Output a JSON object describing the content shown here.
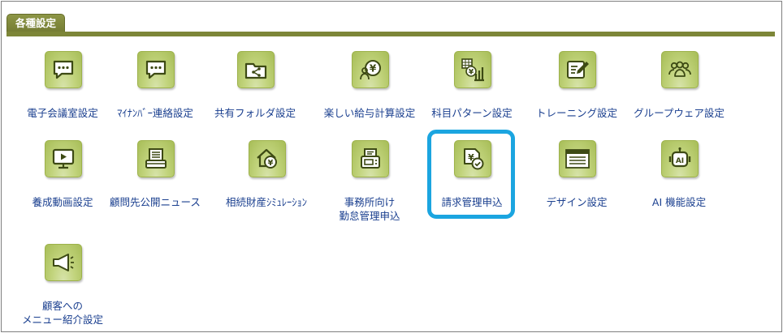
{
  "panel": {
    "tab_label": "各種設定"
  },
  "items": [
    {
      "label": "電子会議室設定",
      "icon": "chat-bubble-icon"
    },
    {
      "label": "ﾏｲﾅﾝﾊﾞｰ連絡設定",
      "icon": "chat-bubble-icon"
    },
    {
      "label": "共有フォルダ設定",
      "icon": "share-folder-icon"
    },
    {
      "label": "楽しい給与計算設定",
      "icon": "yen-people-icon"
    },
    {
      "label": "科目パターン設定",
      "icon": "yen-chart-icon"
    },
    {
      "label": "トレーニング設定",
      "icon": "pen-note-icon"
    },
    {
      "label": "グループウェア設定",
      "icon": "group-icon"
    },
    {
      "label": "養成動画設定",
      "icon": "video-play-icon"
    },
    {
      "label": "顧問先公開ニュース",
      "icon": "document-tray-icon"
    },
    {
      "label": "相続財産ｼﾐｭﾚｰｼｮﾝ",
      "icon": "house-yen-icon"
    },
    {
      "label": "事務所向け\n勤怠管理申込",
      "icon": "fax-machine-icon"
    },
    {
      "label": "請求管理申込",
      "icon": "yen-document-check-icon"
    },
    {
      "label": "デザイン設定",
      "icon": "window-layout-icon"
    },
    {
      "label": "AI 機能設定",
      "icon": "ai-robot-icon"
    },
    {
      "label": "顧客への\nメニュー紹介設定",
      "icon": "megaphone-icon"
    }
  ],
  "highlight_target": "請求管理申込",
  "colors": {
    "accent": "#7d8638",
    "link": "#1a3f8f",
    "highlight": "#1ba5e0",
    "icon_bg": "#c2d47d"
  }
}
